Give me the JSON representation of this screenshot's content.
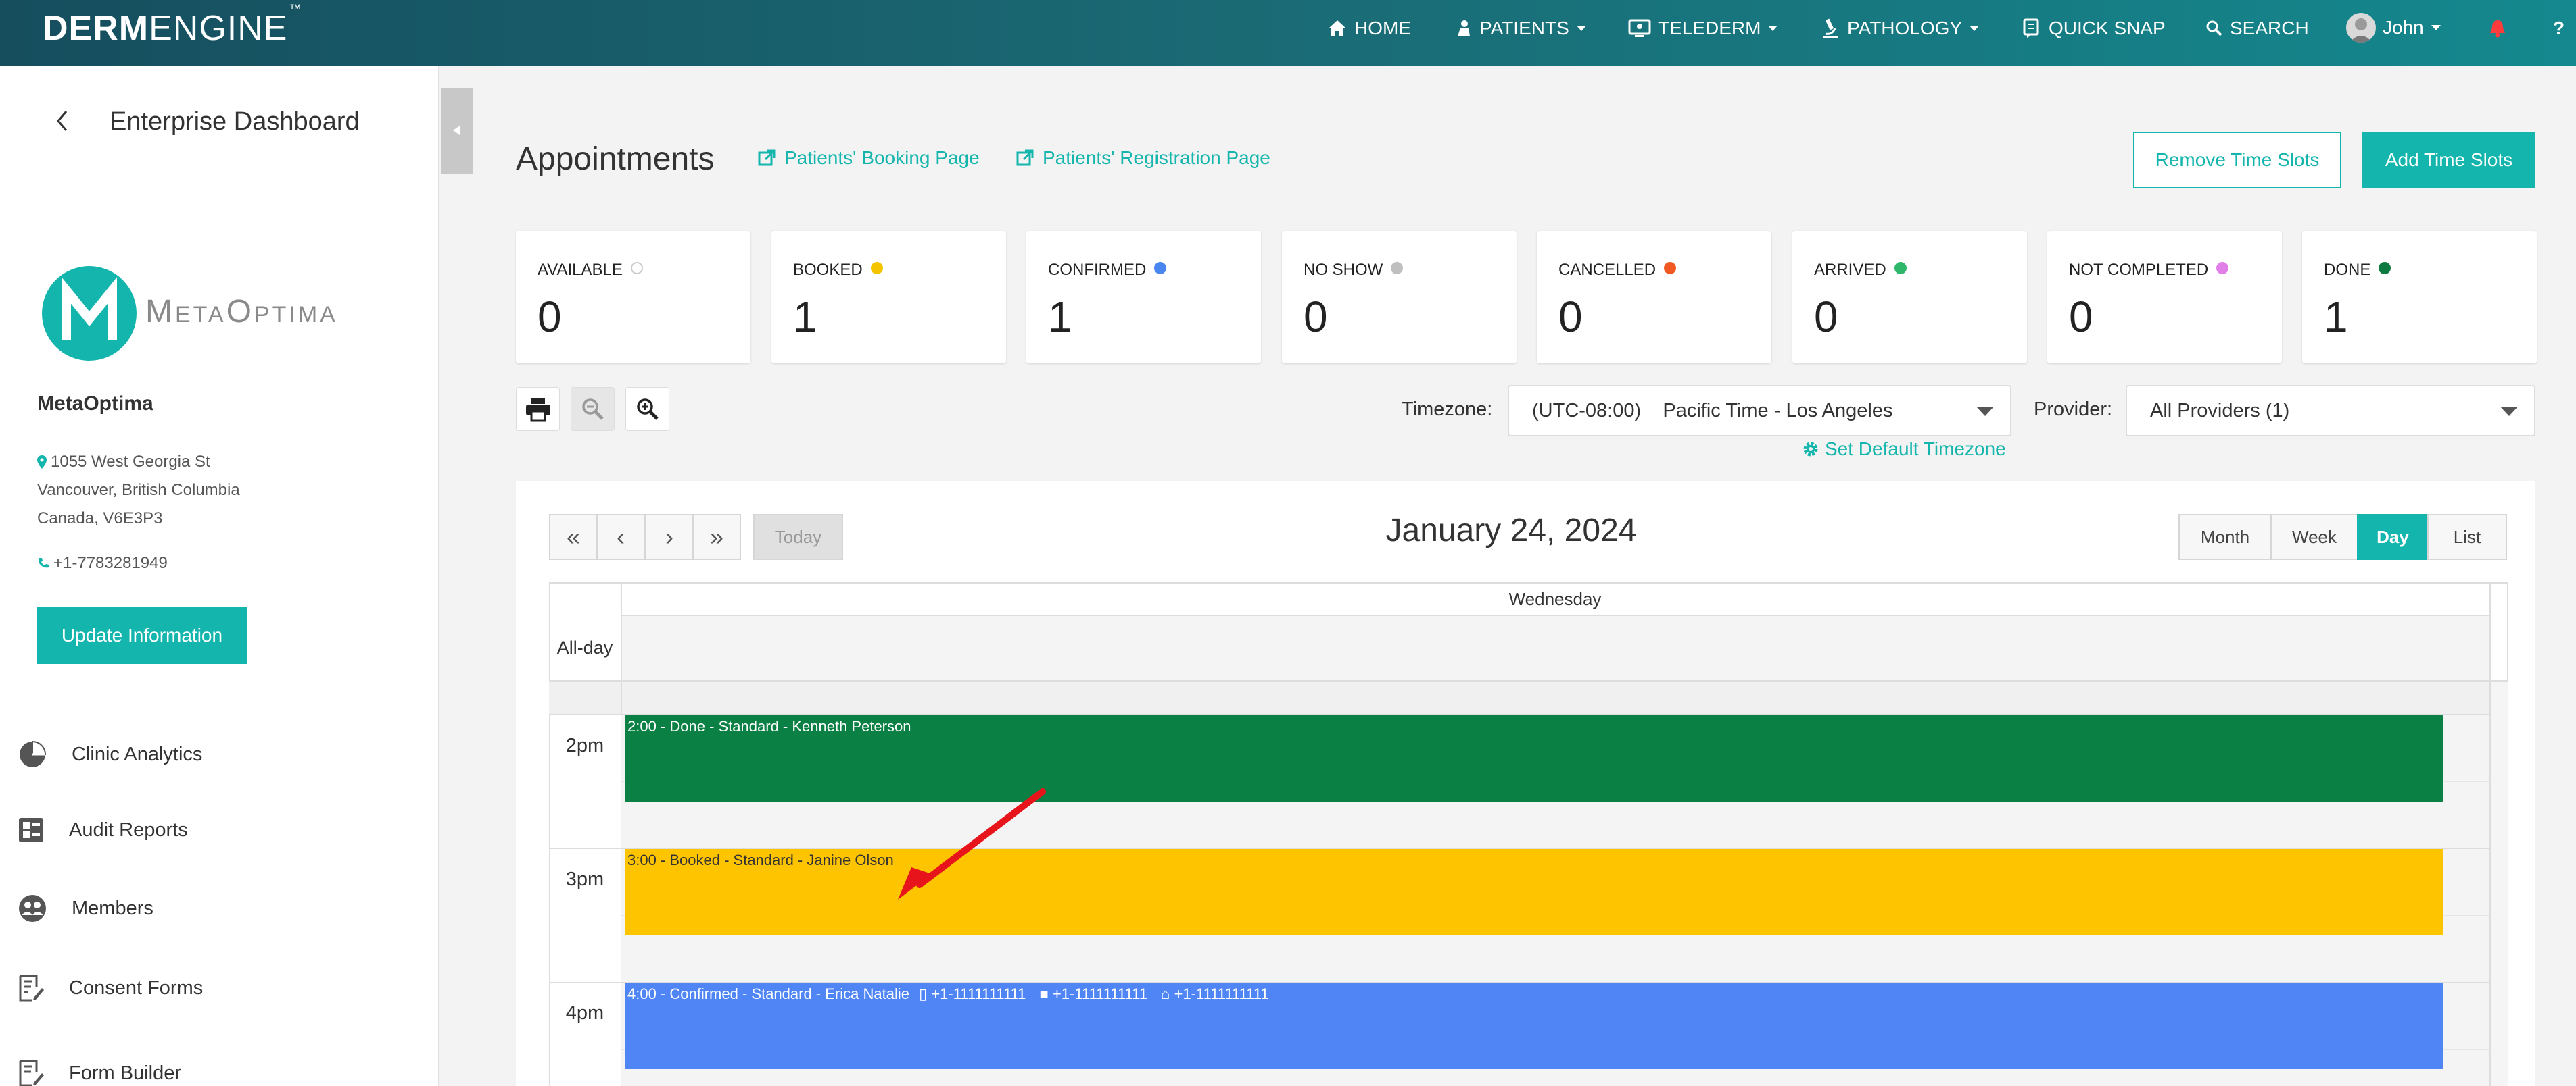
{
  "brand": {
    "name_bold": "DERM",
    "name_light": "ENGINE",
    "trademark": "™"
  },
  "nav": {
    "home": "HOME",
    "patients": "PATIENTS",
    "telederm": "TELEDERM",
    "pathology": "PATHOLOGY",
    "quick_snap": "QUICK SNAP",
    "search": "SEARCH",
    "user": "John",
    "help": "?"
  },
  "sidebar": {
    "back_title": "Enterprise Dashboard",
    "logo_text": "MetaOptima",
    "clinic_name": "MetaOptima",
    "address_line1": "1055 West Georgia St",
    "address_line2": "Vancouver, British Columbia",
    "address_line3": "Canada, V6E3P3",
    "phone": "+1-7783281949",
    "update_button": "Update Information",
    "menu": [
      {
        "label": "Clinic Analytics",
        "icon": "pie-chart-icon"
      },
      {
        "label": "Audit Reports",
        "icon": "report-icon"
      },
      {
        "label": "Members",
        "icon": "members-icon"
      },
      {
        "label": "Consent Forms",
        "icon": "consent-form-icon"
      },
      {
        "label": "Form Builder",
        "icon": "form-builder-icon"
      }
    ]
  },
  "page": {
    "title": "Appointments",
    "booking_link": "Patients' Booking Page",
    "registration_link": "Patients' Registration Page",
    "remove_slots": "Remove Time Slots",
    "add_slots": "Add Time Slots"
  },
  "stats": [
    {
      "label": "AVAILABLE",
      "value": "0",
      "color": "#ffffff"
    },
    {
      "label": "BOOKED",
      "value": "1",
      "color": "#f5c400"
    },
    {
      "label": "CONFIRMED",
      "value": "1",
      "color": "#4a86f0"
    },
    {
      "label": "NO SHOW",
      "value": "0",
      "color": "#bfbfbf"
    },
    {
      "label": "CANCELLED",
      "value": "0",
      "color": "#f05a22"
    },
    {
      "label": "ARRIVED",
      "value": "0",
      "color": "#2fb86b"
    },
    {
      "label": "NOT COMPLETED",
      "value": "0",
      "color": "#e27ee8"
    },
    {
      "label": "DONE",
      "value": "1",
      "color": "#0d7a42"
    }
  ],
  "filters": {
    "timezone_label": "Timezone:",
    "timezone_value": "(UTC-08:00)    Pacific Time - Los Angeles",
    "set_default": "Set Default Timezone",
    "provider_label": "Provider:",
    "provider_value": "All Providers (1)"
  },
  "calendar": {
    "today": "Today",
    "date": "January 24, 2024",
    "views": {
      "month": "Month",
      "week": "Week",
      "day": "Day",
      "list": "List"
    },
    "active_view": "Day",
    "day_header": "Wednesday",
    "all_day": "All-day",
    "times": [
      "2pm",
      "3pm",
      "4pm"
    ],
    "events": [
      {
        "text": "2:00 - Done - Standard - Kenneth Peterson",
        "color": "#0b8044"
      },
      {
        "text": "3:00 - Booked - Standard - Janine Olson",
        "color": "#ffc400"
      },
      {
        "text": "4:00 - Confirmed - Standard - Erica Natalie",
        "color": "#4f85f5",
        "mobile": "+1-1111111111",
        "work": "+1-1111111111",
        "home": "+1-1111111111"
      }
    ]
  },
  "colors": {
    "accent": "#14b5ad",
    "topbar": "#1a6b75"
  }
}
